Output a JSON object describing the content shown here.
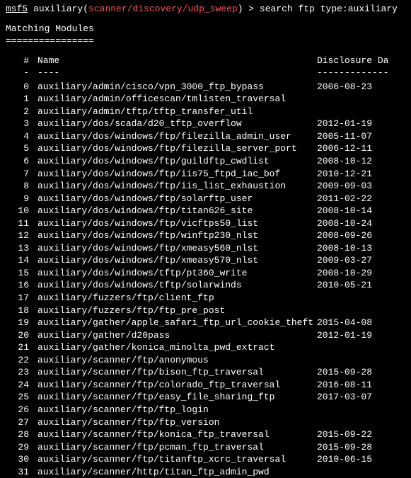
{
  "prompt": {
    "prefix": "msf5",
    "auxiliary_word": " auxiliary(",
    "module": "scanner/discovery/udp_sweep",
    "close": ") > ",
    "command": "search ftp type:auxiliary"
  },
  "section_title": "Matching Modules",
  "section_underline": "================",
  "headers": {
    "idx": "#",
    "idx_ul": "-",
    "name": "Name",
    "name_ul": "----",
    "date": "Disclosure Da",
    "date_ul": "-------------"
  },
  "rows": [
    {
      "idx": "0",
      "name": "auxiliary/admin/cisco/vpn_3000_ftp_bypass",
      "date": "2006-08-23"
    },
    {
      "idx": "1",
      "name": "auxiliary/admin/officescan/tmlisten_traversal",
      "date": ""
    },
    {
      "idx": "2",
      "name": "auxiliary/admin/tftp/tftp_transfer_util",
      "date": ""
    },
    {
      "idx": "3",
      "name": "auxiliary/dos/scada/d20_tftp_overflow",
      "date": "2012-01-19"
    },
    {
      "idx": "4",
      "name": "auxiliary/dos/windows/ftp/filezilla_admin_user",
      "date": "2005-11-07"
    },
    {
      "idx": "5",
      "name": "auxiliary/dos/windows/ftp/filezilla_server_port",
      "date": "2006-12-11"
    },
    {
      "idx": "6",
      "name": "auxiliary/dos/windows/ftp/guildftp_cwdlist",
      "date": "2008-10-12"
    },
    {
      "idx": "7",
      "name": "auxiliary/dos/windows/ftp/iis75_ftpd_iac_bof",
      "date": "2010-12-21"
    },
    {
      "idx": "8",
      "name": "auxiliary/dos/windows/ftp/iis_list_exhaustion",
      "date": "2009-09-03"
    },
    {
      "idx": "9",
      "name": "auxiliary/dos/windows/ftp/solarftp_user",
      "date": "2011-02-22"
    },
    {
      "idx": "10",
      "name": "auxiliary/dos/windows/ftp/titan626_site",
      "date": "2008-10-14"
    },
    {
      "idx": "11",
      "name": "auxiliary/dos/windows/ftp/vicftps50_list",
      "date": "2008-10-24"
    },
    {
      "idx": "12",
      "name": "auxiliary/dos/windows/ftp/winftp230_nlst",
      "date": "2008-09-26"
    },
    {
      "idx": "13",
      "name": "auxiliary/dos/windows/ftp/xmeasy560_nlst",
      "date": "2008-10-13"
    },
    {
      "idx": "14",
      "name": "auxiliary/dos/windows/ftp/xmeasy570_nlst",
      "date": "2009-03-27"
    },
    {
      "idx": "15",
      "name": "auxiliary/dos/windows/tftp/pt360_write",
      "date": "2008-10-29"
    },
    {
      "idx": "16",
      "name": "auxiliary/dos/windows/tftp/solarwinds",
      "date": "2010-05-21"
    },
    {
      "idx": "17",
      "name": "auxiliary/fuzzers/ftp/client_ftp",
      "date": ""
    },
    {
      "idx": "18",
      "name": "auxiliary/fuzzers/ftp/ftp_pre_post",
      "date": ""
    },
    {
      "idx": "19",
      "name": "auxiliary/gather/apple_safari_ftp_url_cookie_theft",
      "date": "2015-04-08"
    },
    {
      "idx": "20",
      "name": "auxiliary/gather/d20pass",
      "date": "2012-01-19"
    },
    {
      "idx": "21",
      "name": "auxiliary/gather/konica_minolta_pwd_extract",
      "date": ""
    },
    {
      "idx": "22",
      "name": "auxiliary/scanner/ftp/anonymous",
      "date": ""
    },
    {
      "idx": "23",
      "name": "auxiliary/scanner/ftp/bison_ftp_traversal",
      "date": "2015-09-28"
    },
    {
      "idx": "24",
      "name": "auxiliary/scanner/ftp/colorado_ftp_traversal",
      "date": "2016-08-11"
    },
    {
      "idx": "25",
      "name": "auxiliary/scanner/ftp/easy_file_sharing_ftp",
      "date": "2017-03-07"
    },
    {
      "idx": "26",
      "name": "auxiliary/scanner/ftp/ftp_login",
      "date": ""
    },
    {
      "idx": "27",
      "name": "auxiliary/scanner/ftp/ftp_version",
      "date": ""
    },
    {
      "idx": "28",
      "name": "auxiliary/scanner/ftp/konica_ftp_traversal",
      "date": "2015-09-22"
    },
    {
      "idx": "29",
      "name": "auxiliary/scanner/ftp/pcman_ftp_traversal",
      "date": "2015-09-28"
    },
    {
      "idx": "30",
      "name": "auxiliary/scanner/ftp/titanftp_xcrc_traversal",
      "date": "2010-06-15"
    },
    {
      "idx": "31",
      "name": "auxiliary/scanner/http/titan_ftp_admin_pwd",
      "date": ""
    }
  ]
}
